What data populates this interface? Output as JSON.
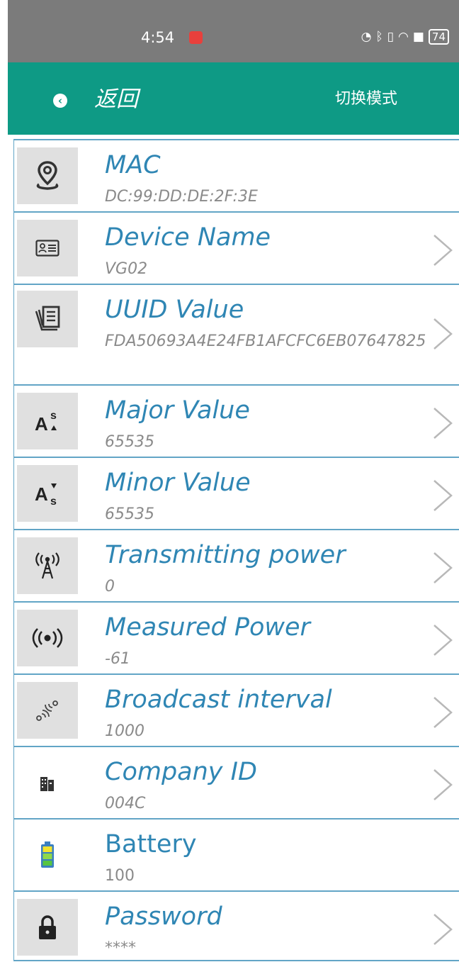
{
  "status_bar": {
    "time": "4:54",
    "battery": "74"
  },
  "header": {
    "back_label": "返回",
    "mode_label": "切换模式"
  },
  "items": [
    {
      "title": "MAC",
      "value": "DC:99:DD:DE:2F:3E",
      "icon": "location-pin-icon",
      "editable": false
    },
    {
      "title": "Device Name",
      "value": "VG02",
      "icon": "id-card-icon",
      "editable": true
    },
    {
      "title": "UUID Value",
      "value": "FDA50693A4E24FB1AFCFC6EB07647825",
      "icon": "document-stack-icon",
      "editable": true
    },
    {
      "title": "Major Value",
      "value": "65535",
      "icon": "font-size-up-icon",
      "editable": true
    },
    {
      "title": "Minor Value",
      "value": "65535",
      "icon": "font-size-down-icon",
      "editable": true
    },
    {
      "title": "Transmitting power",
      "value": "0",
      "icon": "antenna-tower-icon",
      "editable": true
    },
    {
      "title": "Measured Power",
      "value": "-61",
      "icon": "signal-broadcast-icon",
      "editable": true
    },
    {
      "title": "Broadcast interval",
      "value": "1000",
      "icon": "wireless-waves-icon",
      "editable": true
    },
    {
      "title": "Company ID",
      "value": "004C",
      "icon": "building-icon",
      "editable": true
    },
    {
      "title": "Battery",
      "value": "100",
      "icon": "battery-icon",
      "editable": false
    },
    {
      "title": "Password",
      "value": "****",
      "icon": "lock-icon",
      "editable": true
    }
  ],
  "colors": {
    "accent": "#0e9a85",
    "title_text": "#2f86b4",
    "divider": "#62a5c6",
    "value_text": "#8a8a8a"
  }
}
